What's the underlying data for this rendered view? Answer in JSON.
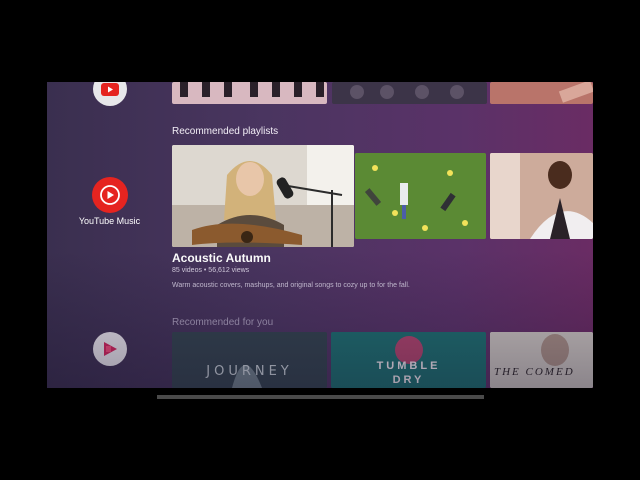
{
  "rail": {
    "apps": [
      {
        "name": "YouTube",
        "icon": "youtube-icon"
      },
      {
        "name": "YouTube Music",
        "icon": "youtube-music-icon"
      },
      {
        "name": "Google Play Movies",
        "icon": "play-movies-icon"
      }
    ],
    "focused_label": "YouTube Music"
  },
  "sections": {
    "recommended_playlists": "Recommended playlists",
    "recommended_for_you": "Recommended for you"
  },
  "featured_playlist": {
    "title": "Acoustic Autumn",
    "meta": "85 videos • 56,612 views",
    "description": "Warm acoustic covers, mashups, and original songs to cozy up to for the fall."
  },
  "bottom_row": {
    "journey": "JOURNEY",
    "tumble_line1": "TUMBLE",
    "tumble_line2": "DRY",
    "comedy": "THE COMED"
  },
  "colors": {
    "youtube_red": "#e52420",
    "background_start": "#3a2f4f",
    "background_end": "#6a2c64"
  }
}
